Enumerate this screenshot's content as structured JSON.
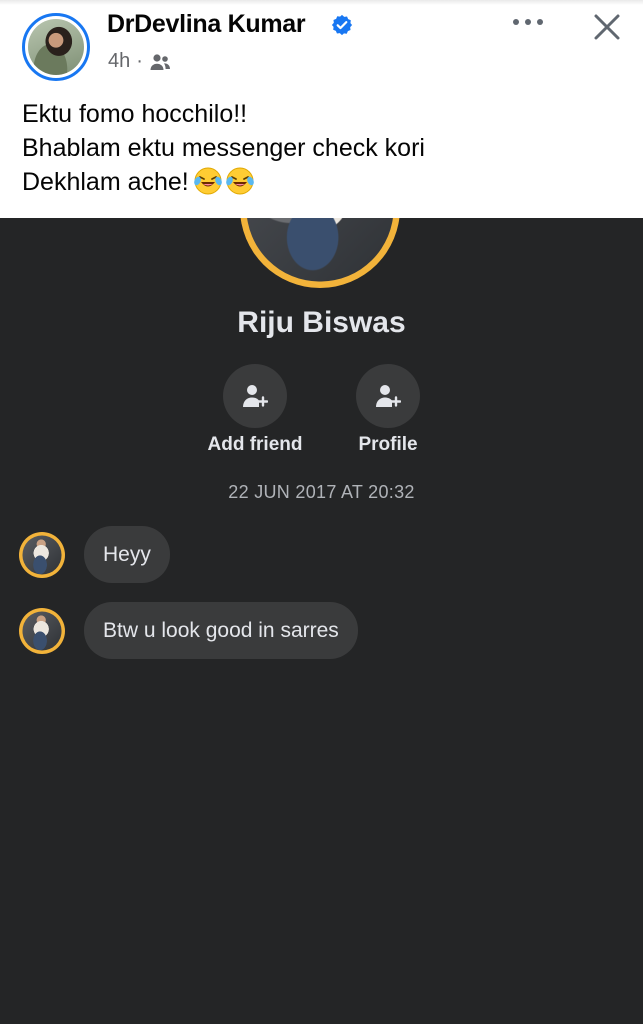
{
  "post": {
    "author_name": "DrDevlina Kumar",
    "verified_icon": "verified-badge-icon",
    "time": "4h",
    "separator": "·",
    "audience_icon": "friends-icon",
    "more_icon": "more-options-icon",
    "close_icon": "close-icon",
    "text_lines": [
      "Ektu fomo hocchilo!!",
      "Bhablam ektu messenger check kori",
      "Dekhlam ache!"
    ],
    "emoji": "laughing-crying-emoji",
    "emoji_count": 2
  },
  "messenger": {
    "contact_name": "Riju Biswas",
    "actions": [
      {
        "label": "Add friend",
        "icon": "add-person-icon"
      },
      {
        "label": "Profile",
        "icon": "add-person-icon"
      }
    ],
    "timestamp": "22 JUN 2017 AT 20:32",
    "messages": [
      {
        "text": "Heyy"
      },
      {
        "text": "Btw u look good in sarres"
      }
    ]
  },
  "colors": {
    "accent": "#1877f2",
    "dark_background": "#242526",
    "bubble": "#3a3b3c",
    "text_light": "#e4e6eb",
    "text_muted": "#b0b3b8"
  }
}
